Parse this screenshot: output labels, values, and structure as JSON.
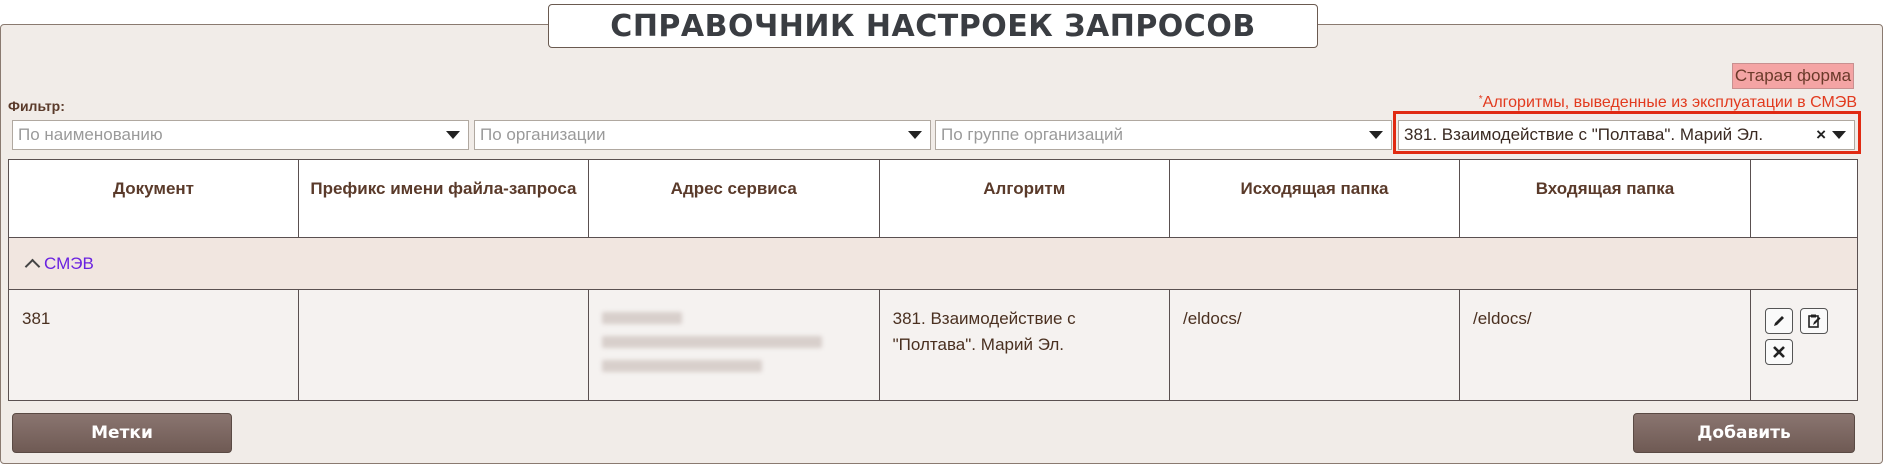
{
  "header": {
    "title": "СПРАВОЧНИК НАСТРОЕК ЗАПРОСОВ"
  },
  "filters": {
    "label": "Фильтр:",
    "old_form_label": "Старая форма",
    "note_star": "*",
    "note_text": "Алгоритмы, выведенные из эксплуатации в СМЭВ",
    "by_name_placeholder": "По наименованию",
    "by_org_placeholder": "По организации",
    "by_group_placeholder": "По группе организаций",
    "algorithm_value": "381. Взаимодействие с \"Полтава\". Марий Эл.",
    "clear_symbol": "×"
  },
  "table": {
    "headers": [
      "Документ",
      "Префикс имени файла-запроса",
      "Адрес сервиса",
      "Алгоритм",
      "Исходящая папка",
      "Входящая папка",
      ""
    ],
    "group_label": "СМЭВ",
    "rows": [
      {
        "document": "381",
        "prefix": "",
        "address": "",
        "algorithm": "381. Взаимодействие с \"Полтава\". Марий Эл.",
        "out_folder": "/eldocs/",
        "in_folder": "/eldocs/"
      }
    ]
  },
  "buttons": {
    "tags_label": "Метки",
    "add_label": "Добавить"
  },
  "icons": {
    "edit": "pencil-icon",
    "copy": "clipboard-edit-icon",
    "delete": "close-icon",
    "collapse": "chevron-up-icon"
  },
  "colors": {
    "highlight": "#e02a12",
    "accent_link": "#6a22e0",
    "note": "#e23a1e"
  }
}
